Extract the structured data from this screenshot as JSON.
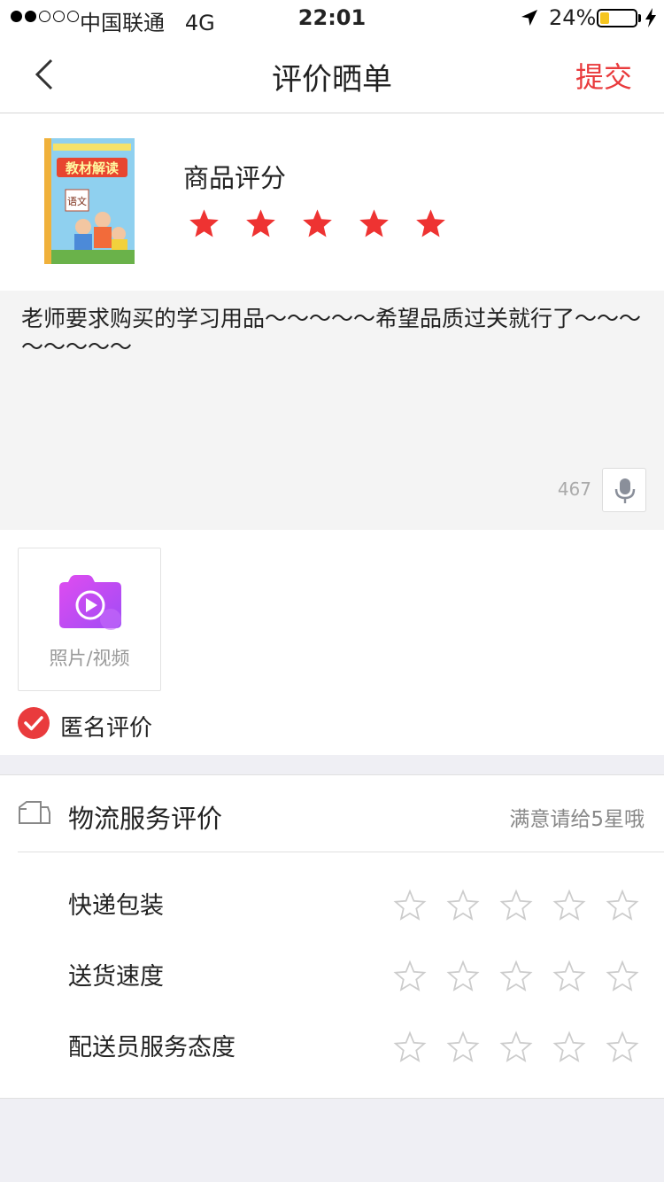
{
  "status_bar": {
    "carrier": "中国联通",
    "network": "4G",
    "time": "22:01",
    "battery_percent": "24%",
    "battery_level": 0.24,
    "signal_bars_filled": 2,
    "signal_bars_total": 5
  },
  "nav": {
    "title": "评价晒单",
    "submit_label": "提交"
  },
  "product": {
    "rating_label": "商品评分",
    "rating": 5,
    "rating_max": 5,
    "image_title": "教材解读",
    "image_subtitle": "语文"
  },
  "comment": {
    "text": "老师要求购买的学习用品～～～～～希望品质过关就行了～～～～～～～～",
    "char_count": "467"
  },
  "media": {
    "upload_label": "照片/视频",
    "anonymous_label": "匿名评价",
    "anonymous_checked": true
  },
  "logistics": {
    "title": "物流服务评价",
    "hint": "满意请给5星哦",
    "items": [
      {
        "label": "快递包装",
        "rating": 0
      },
      {
        "label": "送货速度",
        "rating": 0
      },
      {
        "label": "配送员服务态度",
        "rating": 0
      }
    ]
  },
  "colors": {
    "accent_red": "#e93b3d",
    "star_red": "#ee3332",
    "star_outline": "#cccccc",
    "camera_gradient_start": "#e04cf0",
    "camera_gradient_end": "#a04cf5"
  }
}
